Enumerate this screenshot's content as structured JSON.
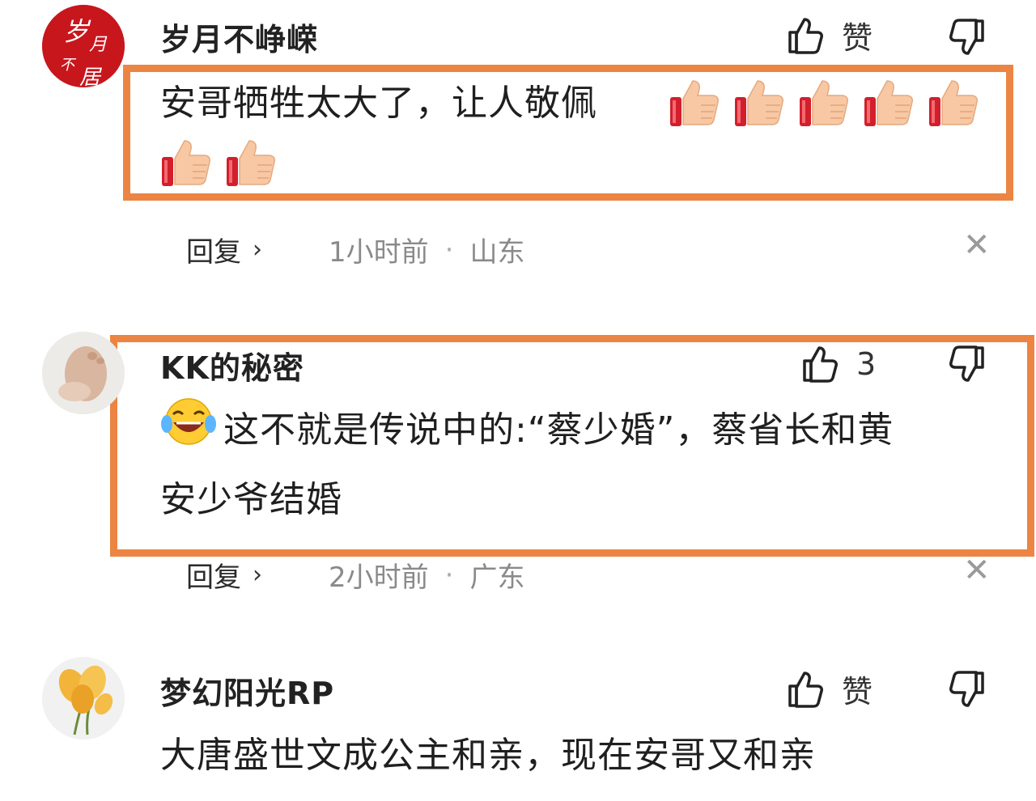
{
  "comments": [
    {
      "username": "岁月不峥嵘",
      "avatar_text": [
        "岁",
        "月",
        "不",
        "居"
      ],
      "text_line1": "安哥牺牲太大了，让人敬佩",
      "thumbs_count": 7,
      "like_label": "赞",
      "reply_label": "回复",
      "time": "1小时前",
      "location": "山东"
    },
    {
      "username": "KK的秘密",
      "text_line1": "这不就是传说中的:“蔡少婚”，蔡省长和黄",
      "text_line2": "安少爷结婚",
      "like_label": "3",
      "reply_label": "回复",
      "time": "2小时前",
      "location": "广东"
    },
    {
      "username": "梦幻阳光RP",
      "text_line1": "大唐盛世文成公主和亲，现在安哥又和亲",
      "like_label": "赞"
    }
  ],
  "separator": "·",
  "icons": {
    "like": "thumbs-up-icon",
    "dislike": "thumbs-down-icon",
    "close": "close-icon",
    "chevron": "chevron-right-icon",
    "emoji_thumb": "thumbs-up-emoji",
    "emoji_laugh": "laughing-emoji"
  },
  "colors": {
    "highlight": "#ec8543",
    "avatar_red": "#c8161d"
  }
}
